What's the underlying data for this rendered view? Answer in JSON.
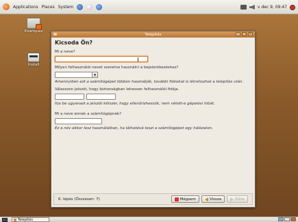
{
  "top_panel": {
    "menus": [
      "Applications",
      "Places",
      "System"
    ],
    "clock": "v dec 9, 09:47"
  },
  "desktop": {
    "icons": [
      {
        "label": "Examples"
      },
      {
        "label": "Install"
      }
    ]
  },
  "window": {
    "title": "Telepítés",
    "heading": "Kicsoda Ön?",
    "name_question": "Mi a neve?",
    "name_value": "",
    "username_question": "Milyen felhasználói nevet szeretne használni a bejelentkezéshez?",
    "username_value": "",
    "username_note": "Amennyiben ezt a számítógépet többen használják, további fiókokat is létrehozhat a telepítés után.",
    "password_question": "Válasszon jelszót, hogy biztonságban lehessen felhasználói fiókja.",
    "password_value": "",
    "password_confirm_value": "",
    "password_note": "Írja be ugyanazt a jelszót kétszer, hogy ellenőrizhessük, nem vétett-e gépelési hibát.",
    "hostname_question": "Mi a neve ennek a számítógépnek?",
    "hostname_value": "",
    "hostname_note": "Ez a név akkor lesz használatban, ha láthatóvá teszi a számítógépet egy hálózaton.",
    "step": "6. lépés (Összesen: 7)",
    "buttons": {
      "cancel": "Mégsem",
      "back": "Vissza",
      "forward": "Előre"
    }
  },
  "taskbar": {
    "task": "Telepítés"
  },
  "colors": {
    "accent": "#b9773b",
    "window_bg": "#efebe3"
  }
}
